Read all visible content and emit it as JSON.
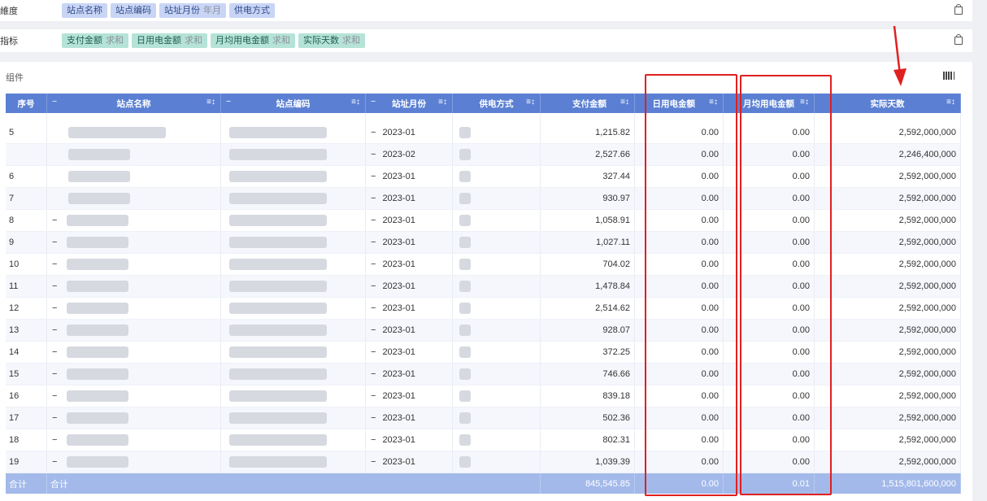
{
  "dimensions": {
    "label": "維度",
    "chips": [
      {
        "label": "站点名称",
        "suffix": ""
      },
      {
        "label": "站点编码",
        "suffix": ""
      },
      {
        "label": "站址月份",
        "suffix": "年月"
      },
      {
        "label": "供电方式",
        "suffix": ""
      }
    ]
  },
  "metrics": {
    "label": "指标",
    "chips": [
      {
        "label": "支付金额",
        "suffix": "求和"
      },
      {
        "label": "日用电金额",
        "suffix": "求和"
      },
      {
        "label": "月均用电金额",
        "suffix": "求和"
      },
      {
        "label": "实际天数",
        "suffix": "求和"
      }
    ]
  },
  "widget": {
    "title": "组件",
    "settings_icon": "barcode-icon"
  },
  "table": {
    "headers": [
      "序号",
      "站点名称",
      "站点编码",
      "站址月份",
      "供电方式",
      "支付金额",
      "日用电金额",
      "月均用电金额",
      "实际天数"
    ],
    "collapse_glyph": "−",
    "sort_glyph": "≡↕",
    "rows": [
      {
        "index": "",
        "month": "2023-01",
        "pay": "1,215.82",
        "daily": "0.00",
        "monthly": "0.00",
        "days": "2,592,000,000",
        "group": "5"
      },
      {
        "index": "",
        "month": "2023-02",
        "pay": "2,527.66",
        "daily": "0.00",
        "monthly": "0.00",
        "days": "2,246,400,000"
      },
      {
        "index": "6",
        "month": "2023-01",
        "pay": "327.44",
        "daily": "0.00",
        "monthly": "0.00",
        "days": "2,592,000,000"
      },
      {
        "index": "7",
        "month": "2023-01",
        "pay": "930.97",
        "daily": "0.00",
        "monthly": "0.00",
        "days": "2,592,000,000"
      },
      {
        "index": "8",
        "month": "2023-01",
        "pay": "1,058.91",
        "daily": "0.00",
        "monthly": "0.00",
        "days": "2,592,000,000"
      },
      {
        "index": "9",
        "month": "2023-01",
        "pay": "1,027.11",
        "daily": "0.00",
        "monthly": "0.00",
        "days": "2,592,000,000"
      },
      {
        "index": "10",
        "month": "2023-01",
        "pay": "704.02",
        "daily": "0.00",
        "monthly": "0.00",
        "days": "2,592,000,000"
      },
      {
        "index": "11",
        "month": "2023-01",
        "pay": "1,478.84",
        "daily": "0.00",
        "monthly": "0.00",
        "days": "2,592,000,000"
      },
      {
        "index": "12",
        "month": "2023-01",
        "pay": "2,514.62",
        "daily": "0.00",
        "monthly": "0.00",
        "days": "2,592,000,000"
      },
      {
        "index": "13",
        "month": "2023-01",
        "pay": "928.07",
        "daily": "0.00",
        "monthly": "0.00",
        "days": "2,592,000,000"
      },
      {
        "index": "14",
        "month": "2023-01",
        "pay": "372.25",
        "daily": "0.00",
        "monthly": "0.00",
        "days": "2,592,000,000"
      },
      {
        "index": "15",
        "month": "2023-01",
        "pay": "746.66",
        "daily": "0.00",
        "monthly": "0.00",
        "days": "2,592,000,000"
      },
      {
        "index": "16",
        "month": "2023-01",
        "pay": "839.18",
        "daily": "0.00",
        "monthly": "0.00",
        "days": "2,592,000,000"
      },
      {
        "index": "17",
        "month": "2023-01",
        "pay": "502.36",
        "daily": "0.00",
        "monthly": "0.00",
        "days": "2,592,000,000"
      },
      {
        "index": "18",
        "month": "2023-01",
        "pay": "802.31",
        "daily": "0.00",
        "monthly": "0.00",
        "days": "2,592,000,000"
      },
      {
        "index": "19",
        "month": "2023-01",
        "pay": "1,039.39",
        "daily": "0.00",
        "monthly": "0.00",
        "days": "2,592,000,000"
      }
    ],
    "footer": {
      "label": "合计",
      "sub_label": "合计",
      "pay": "845,545.85",
      "daily": "0.00",
      "monthly": "0.01",
      "days": "1,515,801,600,000"
    }
  },
  "annotations": {
    "color": "#e02020"
  },
  "colors": {
    "header": "#5b80d3",
    "footer": "#a3b9ea",
    "dimension_chip": "#c9d5f5",
    "metric_chip": "#b5e3d7"
  }
}
